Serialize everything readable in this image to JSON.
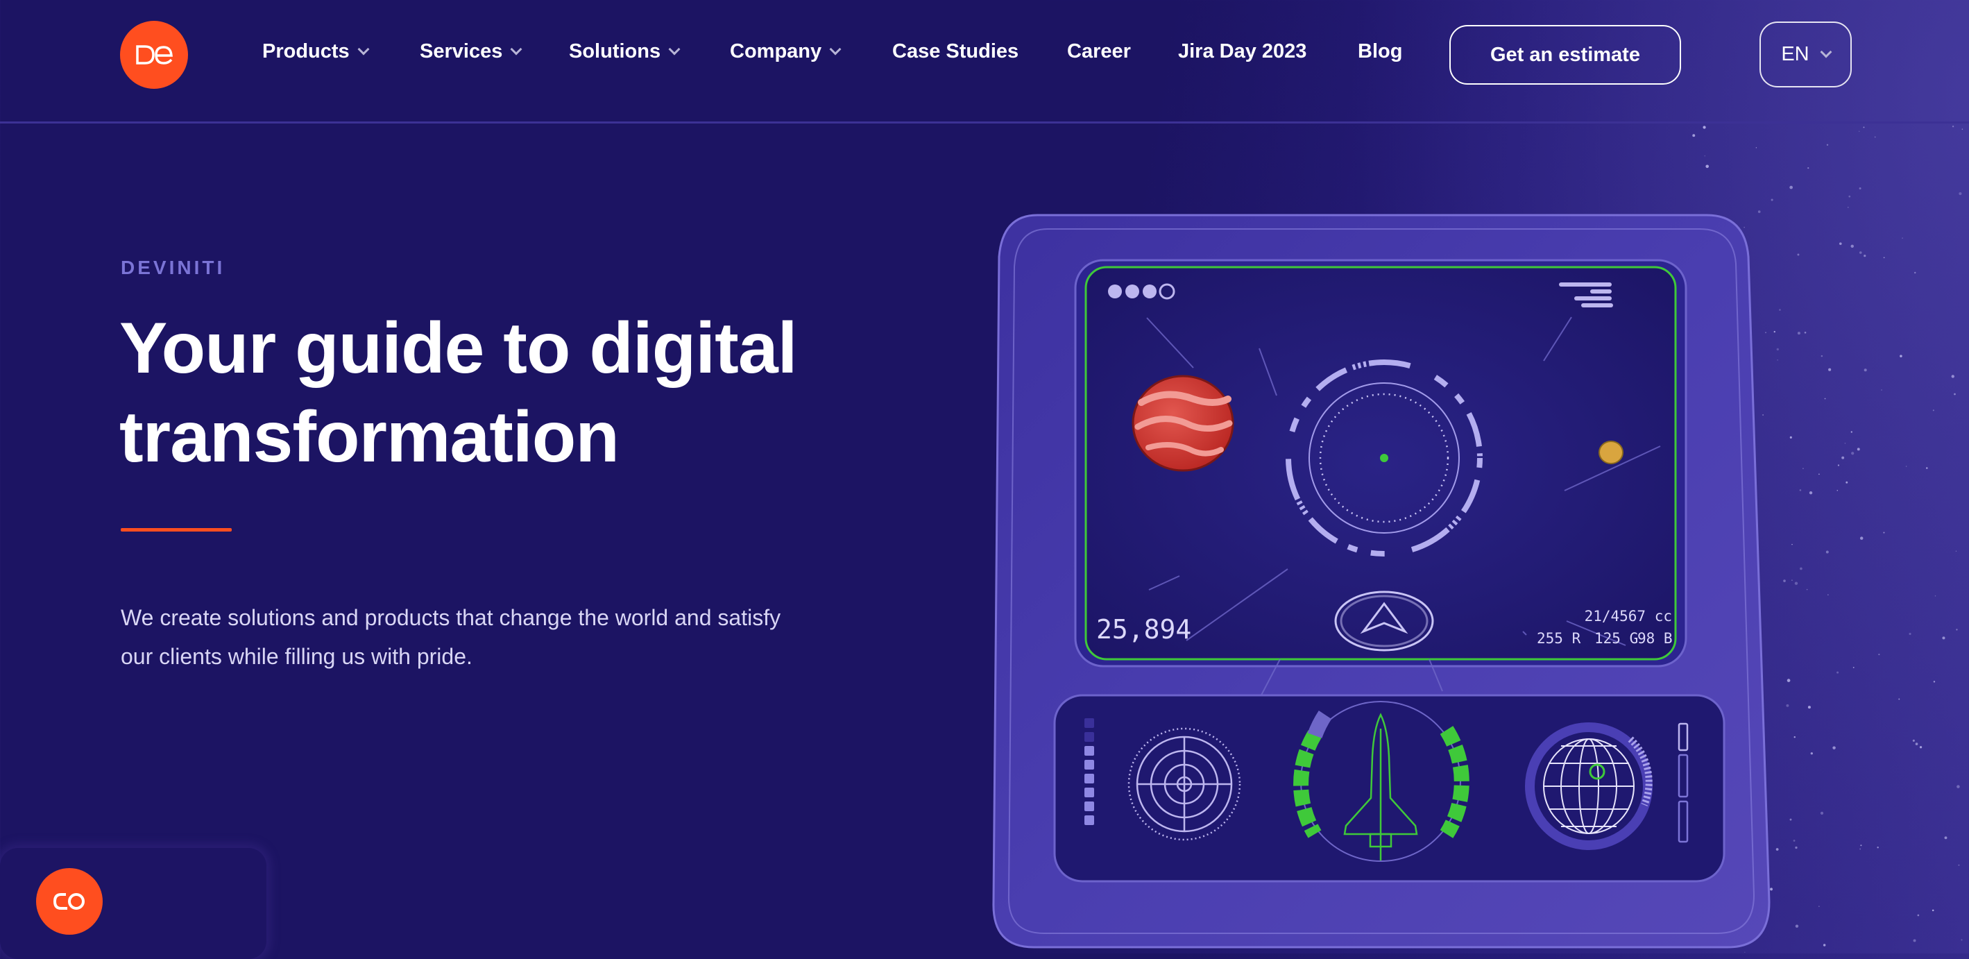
{
  "header": {
    "logo_text": "De",
    "nav": [
      {
        "label": "Products",
        "has_dropdown": true
      },
      {
        "label": "Services",
        "has_dropdown": true
      },
      {
        "label": "Solutions",
        "has_dropdown": true
      },
      {
        "label": "Company",
        "has_dropdown": true
      },
      {
        "label": "Case Studies",
        "has_dropdown": false
      },
      {
        "label": "Career",
        "has_dropdown": false
      },
      {
        "label": "Jira Day 2023",
        "has_dropdown": false
      },
      {
        "label": "Blog",
        "has_dropdown": false
      }
    ],
    "cta_label": "Get an estimate",
    "language": "EN"
  },
  "hero": {
    "eyebrow": "DEVINITI",
    "title_line1": "Your guide to digital",
    "title_line2": "transformation",
    "lead_line1": "We create solutions and products that change the world and satisfy",
    "lead_line2": "our clients while filling us with pride."
  },
  "illustration": {
    "counter": "25,894",
    "volume": "21/4567 cc",
    "rgb_r": "255 R",
    "rgb_g": "125 G",
    "rgb_b": "98 B"
  },
  "chat_widget": {
    "icon": "chat-logo-icon"
  },
  "colors": {
    "background": "#1c1463",
    "accent": "#ff4e1f",
    "eyebrow": "#7b74d6",
    "hud_green": "#3fc93a",
    "device": "#4b3fb0"
  }
}
